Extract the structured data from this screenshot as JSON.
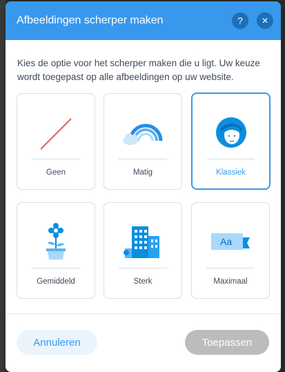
{
  "dialog": {
    "title": "Afbeeldingen scherper maken",
    "help_symbol": "?",
    "close_symbol": "✕",
    "description": "Kies de optie voor het scherper maken die u ligt. Uw keuze wordt toegepast op alle afbeeldingen op uw website."
  },
  "options": [
    {
      "label": "Geen",
      "icon": "no-sharpen-slash-icon",
      "selected": false
    },
    {
      "label": "Matig",
      "icon": "cloud-rainbow-icon",
      "selected": false
    },
    {
      "label": "Klassiek",
      "icon": "woman-face-icon",
      "selected": true
    },
    {
      "label": "Gemiddeld",
      "icon": "potted-flower-icon",
      "selected": false
    },
    {
      "label": "Sterk",
      "icon": "city-buildings-icon",
      "selected": false
    },
    {
      "label": "Maximaal",
      "icon": "flag-banner-aa-icon",
      "selected": false
    }
  ],
  "icon_texts": {
    "flag_text": "Aa"
  },
  "footer": {
    "cancel_label": "Annuleren",
    "apply_label": "Toepassen"
  },
  "colors": {
    "accent": "#3899ec",
    "slash": "#e5605c",
    "disabled": "#bcbcbc"
  }
}
